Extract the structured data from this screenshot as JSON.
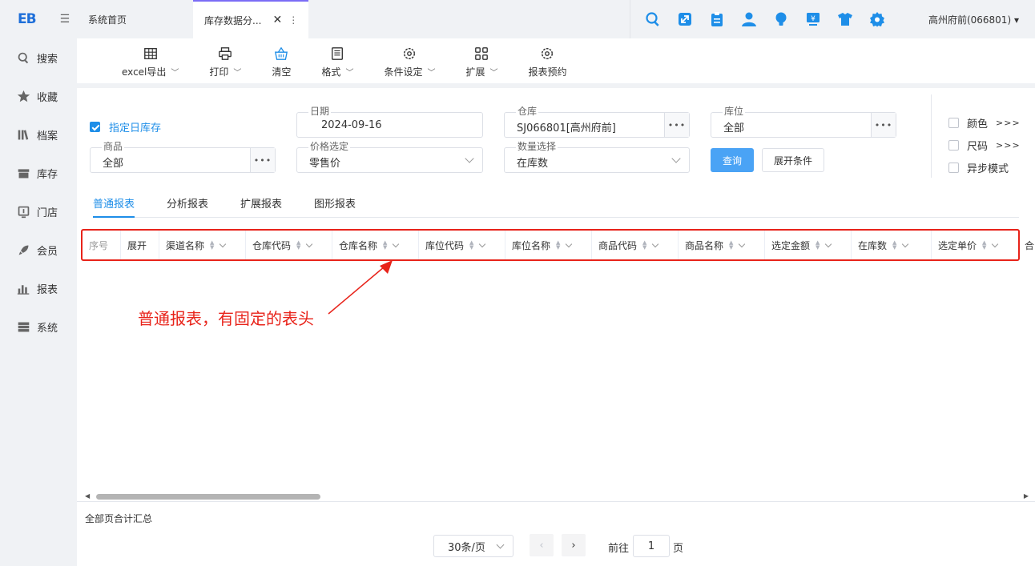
{
  "brand": {
    "logo": "EB",
    "collapse_icon": "menu-fold-icon"
  },
  "sidebar": {
    "items": [
      {
        "label": "搜索",
        "icon": "search-icon"
      },
      {
        "label": "收藏",
        "icon": "star-icon"
      },
      {
        "label": "档案",
        "icon": "books-icon"
      },
      {
        "label": "库存",
        "icon": "box-icon"
      },
      {
        "label": "门店",
        "icon": "store-icon"
      },
      {
        "label": "会员",
        "icon": "rocket-icon"
      },
      {
        "label": "报表",
        "icon": "bar-chart-icon"
      },
      {
        "label": "系统",
        "icon": "server-icon"
      }
    ]
  },
  "tabs": {
    "home": "系统首页",
    "active": "库存数据分...",
    "close_glyph": "✕",
    "more_glyph": "⋮"
  },
  "header": {
    "store": "高州府前(066801)",
    "icons": [
      "search-icon",
      "expand-icon",
      "clipboard-icon",
      "user-icon",
      "bulb-icon",
      "monitor-yuan-icon",
      "shirt-icon",
      "gear-icon"
    ]
  },
  "toolbar": {
    "excel": "excel导出",
    "print": "打印",
    "clear": "清空",
    "format": "格式",
    "condition": "条件设定",
    "extend": "扩展",
    "schedule": "报表预约"
  },
  "filters": {
    "specified_date_stock": "指定日库存",
    "date_label": "日期",
    "date_value": "2024-09-16",
    "warehouse_label": "仓库",
    "warehouse_value": "SJ066801[高州府前]",
    "location_label": "库位",
    "location_value": "全部",
    "goods_label": "商品",
    "goods_value": "全部",
    "price_label": "价格选定",
    "price_value": "零售价",
    "qty_label": "数量选择",
    "qty_value": "在库数",
    "query_btn": "查询",
    "expand_btn": "展开条件",
    "dots": "•••"
  },
  "options": {
    "color": "颜色",
    "size": "尺码",
    "async": "异步模式",
    "more": ">>>"
  },
  "report_tabs": [
    "普通报表",
    "分析报表",
    "扩展报表",
    "图形报表"
  ],
  "table": {
    "columns": [
      {
        "label": "序号",
        "sortable": false
      },
      {
        "label": "展开",
        "sortable": false
      },
      {
        "label": "渠道名称",
        "sortable": true
      },
      {
        "label": "仓库代码",
        "sortable": true
      },
      {
        "label": "仓库名称",
        "sortable": true
      },
      {
        "label": "库位代码",
        "sortable": true
      },
      {
        "label": "库位名称",
        "sortable": true
      },
      {
        "label": "商品代码",
        "sortable": true
      },
      {
        "label": "商品名称",
        "sortable": true
      },
      {
        "label": "选定金额",
        "sortable": true
      },
      {
        "label": "在库数",
        "sortable": true
      },
      {
        "label": "选定单价",
        "sortable": true
      }
    ],
    "extra_col": "合",
    "summary": "全部页合计汇总"
  },
  "annotation": "普通报表，有固定的表头",
  "pager": {
    "page_size": "30条/页",
    "goto_label": "前往",
    "page_value": "1",
    "page_suffix": "页",
    "prev": "‹",
    "next": "›"
  },
  "colors": {
    "accent": "#1e8ee8",
    "annotation": "#e8231a",
    "active_tab": "#7b6cf6"
  }
}
